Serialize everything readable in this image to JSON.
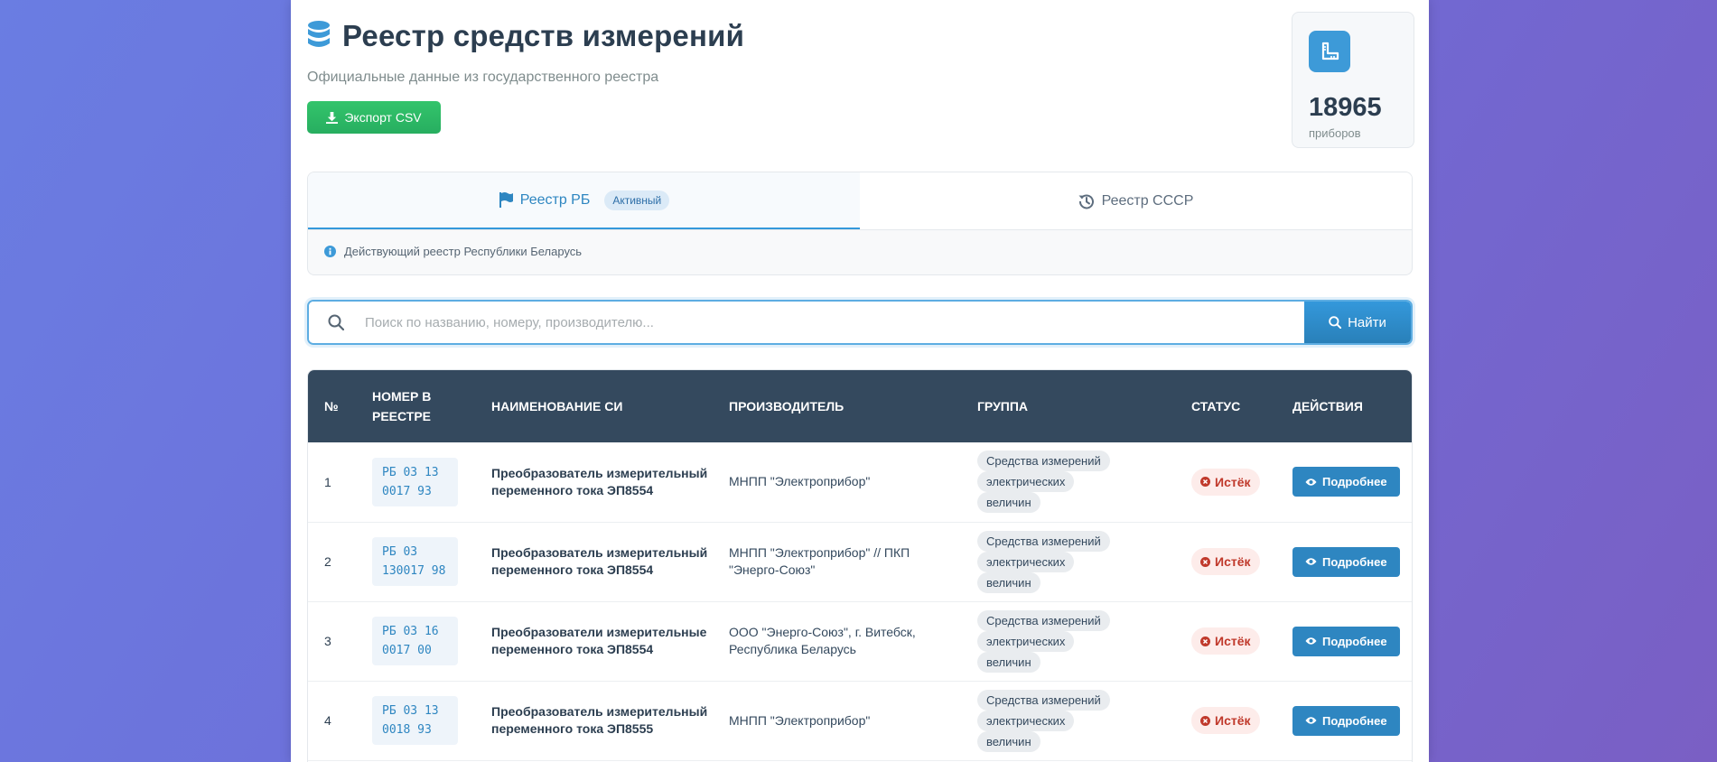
{
  "header": {
    "title": "Реестр средств измерений",
    "subtitle": "Официальные данные из государственного реестра",
    "export_label": "Экспорт CSV"
  },
  "stats": {
    "value": "18965",
    "label": "приборов"
  },
  "tabs": [
    {
      "label": "Реестр РБ",
      "badge": "Активный",
      "active": true,
      "icon": "flag-icon"
    },
    {
      "label": "Реестр СССР",
      "active": false,
      "icon": "history-icon"
    }
  ],
  "info": {
    "text": "Действующий реестр Республики Беларусь",
    "icon": "info-circle-icon"
  },
  "search": {
    "placeholder": "Поиск по названию, номеру, производителю...",
    "value": "",
    "button_label": "Найти"
  },
  "table": {
    "headers": {
      "num": "№",
      "reg": "Номер в реестре",
      "name": "Наименование СИ",
      "maker": "Производитель",
      "group": "Группа",
      "status": "Статус",
      "actions": "Действия"
    },
    "rows": [
      {
        "num": "1",
        "reg": "РБ 03 13\n0017 93",
        "name": "Преобразователь измерительный переменного тока ЭП8554",
        "maker": "МНПП \"Электроприбор\"",
        "group": "Средства измерений электрических величин",
        "status": "Истёк",
        "action": "Подробнее"
      },
      {
        "num": "2",
        "reg": "РБ 03\n130017 98",
        "name": "Преобразователь измерительный переменного тока ЭП8554",
        "maker": "МНПП \"Электроприбор\" // ПКП \"Энерго-Союз\"",
        "group": "Средства измерений электрических величин",
        "status": "Истёк",
        "action": "Подробнее"
      },
      {
        "num": "3",
        "reg": "РБ 03 16\n0017 00",
        "name": "Преобразователи измерительные переменного тока ЭП8554",
        "maker": "ООО \"Энерго-Союз\", г. Витебск, Республика Беларусь",
        "group": "Средства измерений электрических величин",
        "status": "Истёк",
        "action": "Подробнее"
      },
      {
        "num": "4",
        "reg": "РБ 03 13\n0018 93",
        "name": "Преобразователь измерительный переменного тока ЭП8555",
        "maker": "МНПП \"Электроприбор\"",
        "group": "Средства измерений электрических величин",
        "status": "Истёк",
        "action": "Подробнее"
      }
    ]
  },
  "colors": {
    "primary": "#3498db",
    "success": "#2ecc71",
    "header_bg": "#34495e",
    "danger": "#c0392b"
  }
}
